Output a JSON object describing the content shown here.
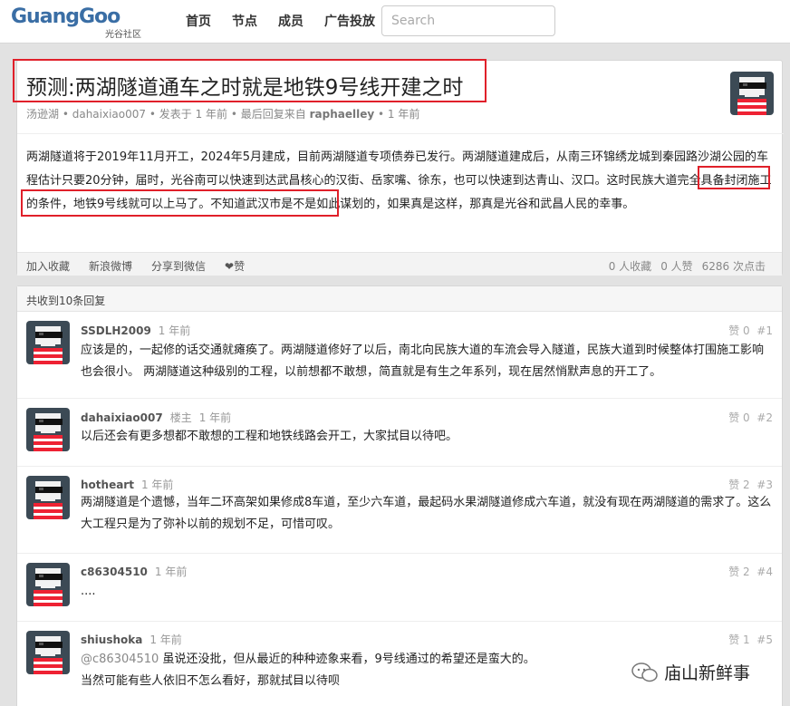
{
  "header": {
    "logo_text": "GuangGoo",
    "logo_sub": "光谷社区",
    "nav": [
      "首页",
      "节点",
      "成员",
      "广告投放"
    ],
    "search_placeholder": "Search"
  },
  "topic": {
    "title": "预测:两湖隧道通车之时就是地铁9号线开建之时",
    "node": "汤逊湖",
    "author": "dahaixiao007",
    "posted": "发表于 1 年前",
    "last_reply_prefix": "最后回复来自",
    "last_reply_user": "raphaelley",
    "last_reply_time": "1 年前",
    "content": "两湖隧道将于2019年11月开工，2024年5月建成，目前两湖隧道专项债券已发行。两湖隧道建成后，从南三环锦绣龙城到秦园路沙湖公园的车程估计只要20分钟，届时，光谷南可以快速到达武昌核心的汉街、岳家嘴、徐东，也可以快速到达青山、汉口。这时民族大道完全具备封闭施工的条件，地铁9号线就可以上马了。不知道武汉市是不是如此谋划的，如果真是这样，那真是光谷和武昌人民的幸事。",
    "actions": [
      "加入收藏",
      "新浪微博",
      "分享到微信",
      "❤赞"
    ],
    "stats": [
      "0 人收藏",
      "0 人赞",
      "6286 次点击"
    ]
  },
  "replies_header": "共收到10条回复",
  "replies": [
    {
      "user": "SSDLH2009",
      "op": "",
      "time": "1 年前",
      "likes": "赞 0",
      "floor": "#1",
      "text": "应该是的，一起修的话交通就瘫痪了。两湖隧道修好了以后，南北向民族大道的车流会导入隧道，民族大道到时候整体打围施工影响也会很小。 两湖隧道这种级别的工程，以前想都不敢想，简直就是有生之年系列，现在居然悄默声息的开工了。"
    },
    {
      "user": "dahaixiao007",
      "op": "楼主",
      "time": "1 年前",
      "likes": "赞 0",
      "floor": "#2",
      "text": "以后还会有更多想都不敢想的工程和地铁线路会开工，大家拭目以待吧。"
    },
    {
      "user": "hotheart",
      "op": "",
      "time": "1 年前",
      "likes": "赞 2",
      "floor": "#3",
      "text": "两湖隧道是个遗憾，当年二环高架如果修成8车道，至少六车道，最起码水果湖隧道修成六车道，就没有现在两湖隧道的需求了。这么大工程只是为了弥补以前的规划不足，可惜可叹。"
    },
    {
      "user": "c86304510",
      "op": "",
      "time": "1 年前",
      "likes": "赞 2",
      "floor": "#4",
      "text": "...."
    },
    {
      "user": "shiushoka",
      "op": "",
      "time": "1 年前",
      "likes": "赞 1",
      "floor": "#5",
      "mention": "@c86304510",
      "text": " 虽说还没批，但从最近的种种迹象来看，9号线通过的希望还是蛮大的。",
      "text2": "当然可能有些人依旧不怎么看好，那就拭目以待呗"
    }
  ],
  "watermark": "庙山新鲜事"
}
